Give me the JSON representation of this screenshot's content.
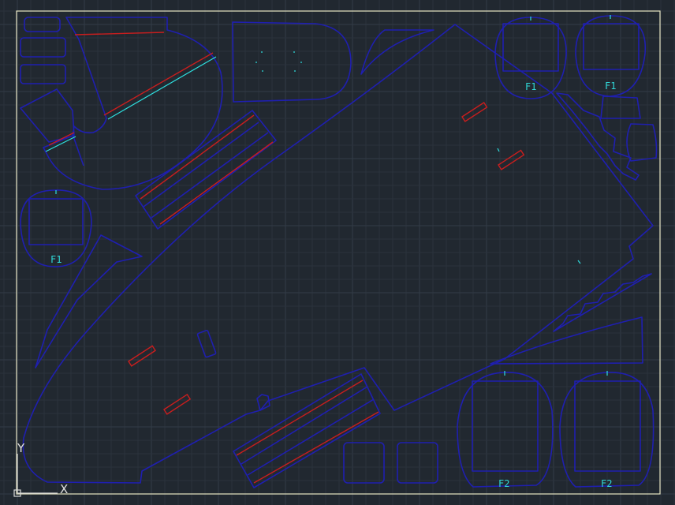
{
  "colors": {
    "background": "#212830",
    "grid_minor": "#2a323c",
    "grid_major": "#333c47",
    "sheet_border": "#e8e6c4",
    "part_outline": "#1f1fb0",
    "red_lines": "#c81e1e",
    "cyan_lines": "#2ee0e0",
    "ucs_icon": "#d8d8d8"
  },
  "part_labels": {
    "f1_a": "F1",
    "f1_b": "F1",
    "f1_c": "F1",
    "f2_a": "F2",
    "f2_b": "F2"
  },
  "ucs": {
    "x_label": "X",
    "y_label": "Y"
  }
}
